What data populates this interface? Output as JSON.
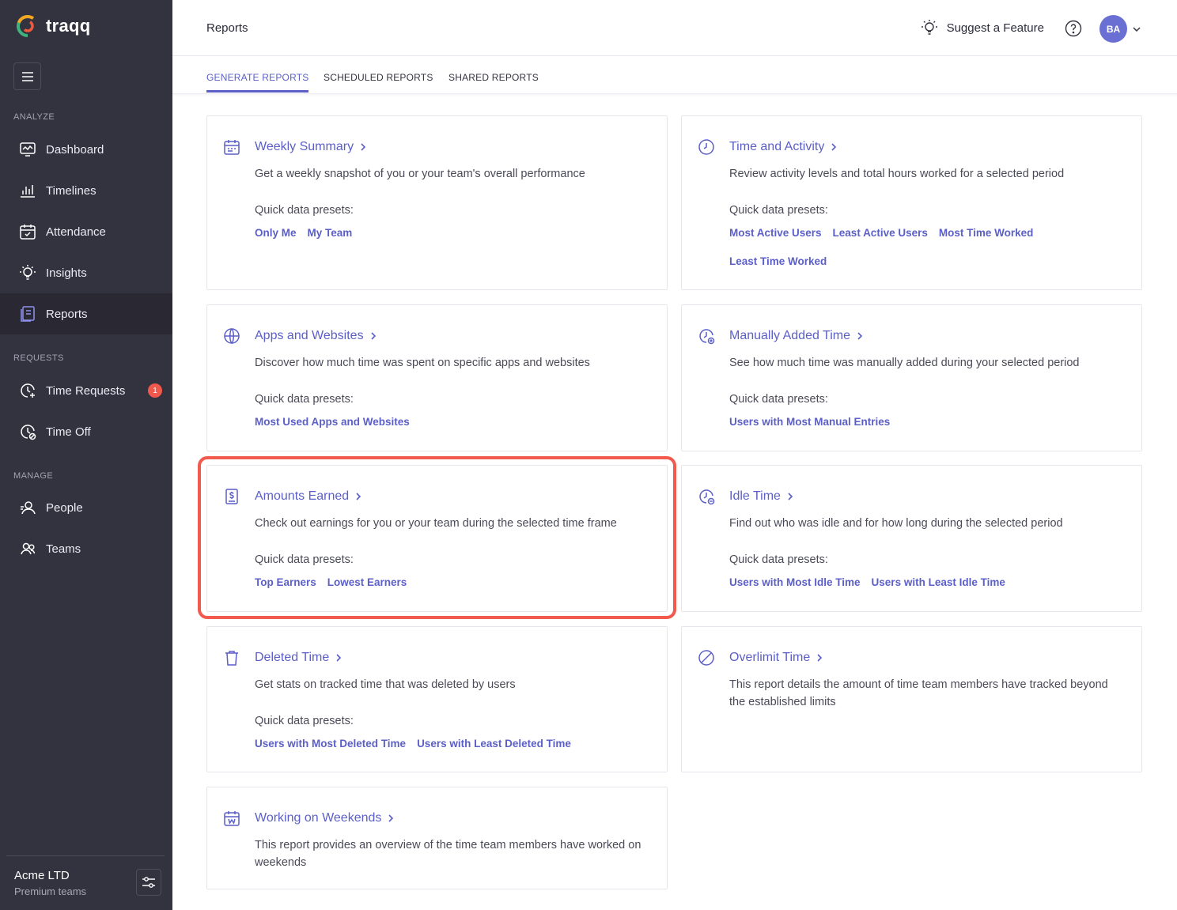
{
  "app": {
    "name": "traqq"
  },
  "sidebar": {
    "sections": {
      "analyze": "ANALYZE",
      "requests": "REQUESTS",
      "manage": "MANAGE"
    },
    "items": [
      {
        "label": "Dashboard",
        "icon": "dashboard-icon"
      },
      {
        "label": "Timelines",
        "icon": "bar-chart-icon"
      },
      {
        "label": "Attendance",
        "icon": "calendar-check-icon"
      },
      {
        "label": "Insights",
        "icon": "lightbulb-icon"
      },
      {
        "label": "Reports",
        "icon": "reports-icon",
        "active": true
      },
      {
        "label": "Time Requests",
        "icon": "clock-plus-icon",
        "badge": "1"
      },
      {
        "label": "Time Off",
        "icon": "clock-off-icon"
      },
      {
        "label": "People",
        "icon": "person-icon"
      },
      {
        "label": "Teams",
        "icon": "team-icon"
      }
    ],
    "footer": {
      "org": "Acme LTD",
      "plan": "Premium teams"
    }
  },
  "header": {
    "title": "Reports",
    "suggest": "Suggest a Feature",
    "avatar": "BA"
  },
  "tabs": [
    {
      "label": "GENERATE REPORTS",
      "active": true
    },
    {
      "label": "SCHEDULED REPORTS"
    },
    {
      "label": "SHARED REPORTS"
    }
  ],
  "presets_label": "Quick data presets:",
  "cards": [
    {
      "title": "Weekly Summary",
      "icon": "calendar-icon",
      "desc": "Get a weekly snapshot of you or your team's overall performance",
      "presets": [
        "Only Me",
        "My Team"
      ]
    },
    {
      "title": "Time and Activity",
      "icon": "clock-icon",
      "desc": "Review activity levels and total hours worked for a selected period",
      "presets": [
        "Most Active Users",
        "Least Active Users",
        "Most Time Worked",
        "Least Time Worked"
      ]
    },
    {
      "title": "Apps and Websites",
      "icon": "globe-icon",
      "desc": "Discover how much time was spent on specific apps and websites",
      "presets": [
        "Most Used Apps and Websites"
      ]
    },
    {
      "title": "Manually Added Time",
      "icon": "clock-plus-icon",
      "desc": "See how much time was manually added during your selected period",
      "presets": [
        "Users with Most Manual Entries"
      ]
    },
    {
      "title": "Amounts Earned",
      "icon": "dollar-document-icon",
      "desc": "Check out earnings for you or your team during the selected time frame",
      "presets": [
        "Top Earners",
        "Lowest Earners"
      ]
    },
    {
      "title": "Idle Time",
      "icon": "clock-minus-icon",
      "desc": "Find out who was idle and for how long during the selected period",
      "presets": [
        "Users with Most Idle Time",
        "Users with Least Idle Time"
      ]
    },
    {
      "title": "Deleted Time",
      "icon": "trash-icon",
      "desc": "Get stats on tracked time that was deleted by users",
      "presets": [
        "Users with Most Deleted Time",
        "Users with Least Deleted Time"
      ]
    },
    {
      "title": "Overlimit Time",
      "icon": "forbidden-icon",
      "desc": "This report details the amount of time team members have tracked beyond the established limits",
      "presets": []
    },
    {
      "title": "Working on Weekends",
      "icon": "calendar-weekend-icon",
      "desc": "This report provides an overview of the time team members have worked on weekends",
      "presets": []
    }
  ],
  "colors": {
    "sidebar_bg": "#33323f",
    "accent": "#5b5fc7",
    "highlight": "#f25a4e",
    "badge": "#f0584c"
  }
}
